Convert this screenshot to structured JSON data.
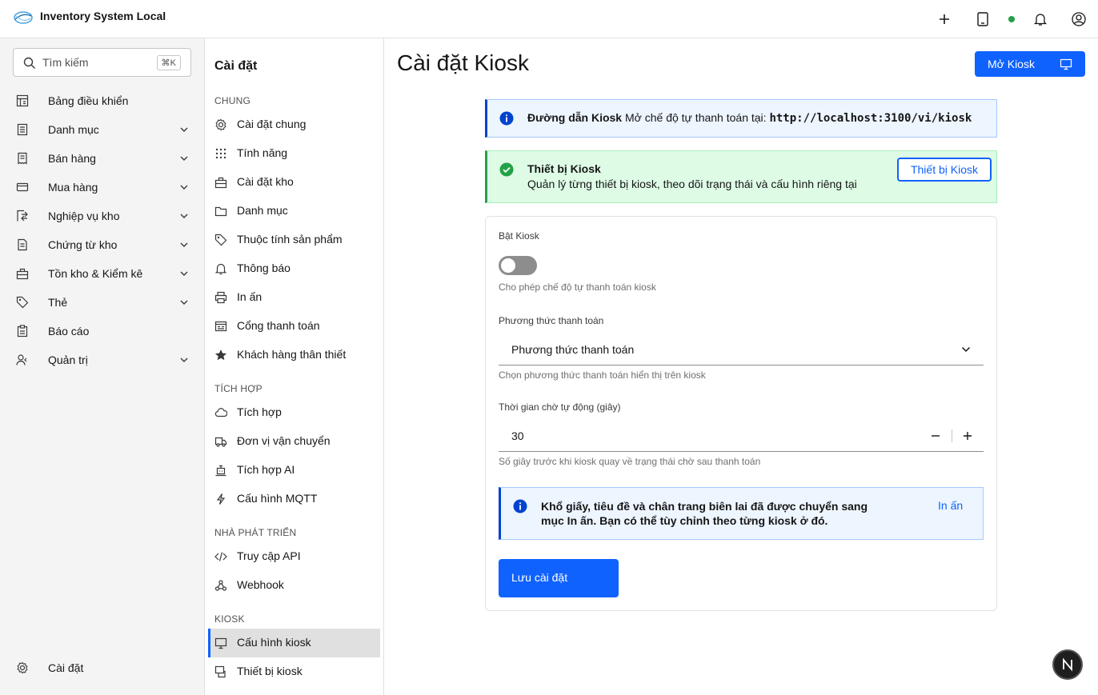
{
  "app": {
    "title": "Inventory System Local"
  },
  "header": {
    "icons": [
      "plus-icon",
      "tablet-icon",
      "status-dot",
      "bell-icon",
      "user-icon"
    ],
    "status_color": "#24a148"
  },
  "sidebar": {
    "search_placeholder": "Tìm kiếm",
    "search_shortcut": "⌘K",
    "items": [
      {
        "label": "Bảng điều khiển",
        "icon": "dashboard-icon",
        "expandable": false
      },
      {
        "label": "Danh mục",
        "icon": "catalog-icon",
        "expandable": true
      },
      {
        "label": "Bán hàng",
        "icon": "sales-icon",
        "expandable": true
      },
      {
        "label": "Mua hàng",
        "icon": "purchase-icon",
        "expandable": true
      },
      {
        "label": "Nghiệp vụ kho",
        "icon": "warehouse-ops-icon",
        "expandable": true
      },
      {
        "label": "Chứng từ kho",
        "icon": "document-icon",
        "expandable": true
      },
      {
        "label": "Tồn kho & Kiểm kê",
        "icon": "inventory-icon",
        "expandable": true
      },
      {
        "label": "Thẻ",
        "icon": "tag-icon",
        "expandable": true
      },
      {
        "label": "Báo cáo",
        "icon": "report-icon",
        "expandable": false
      },
      {
        "label": "Quản trị",
        "icon": "admin-icon",
        "expandable": true
      }
    ],
    "footer_label": "Cài đặt"
  },
  "settings_nav": {
    "title": "Cài đặt",
    "groups": [
      {
        "label": "CHUNG",
        "items": [
          "Cài đặt chung",
          "Tính năng",
          "Cài đặt kho",
          "Danh mục",
          "Thuộc tính sản phẩm",
          "Thông báo",
          "In ấn",
          "Cổng thanh toán",
          "Khách hàng thân thiết"
        ]
      },
      {
        "label": "TÍCH HỢP",
        "items": [
          "Tích hợp",
          "Đơn vị vận chuyển",
          "Tích hợp AI",
          "Cấu hình MQTT"
        ]
      },
      {
        "label": "NHÀ PHÁT TRIỂN",
        "items": [
          "Truy cập API",
          "Webhook"
        ]
      },
      {
        "label": "KIOSK",
        "items": [
          "Cấu hình kiosk",
          "Thiết bị kiosk"
        ]
      }
    ],
    "active_item": "Cấu hình kiosk"
  },
  "main": {
    "title": "Cài đặt Kiosk",
    "open_kiosk_label": "Mở Kiosk",
    "info_notice": {
      "title": "Đường dẫn Kiosk",
      "text": "Mở chế độ tự thanh toán tại:",
      "url": "http://localhost:3100/vi/kiosk"
    },
    "success_notice": {
      "title": "Thiết bị Kiosk",
      "text": "Quản lý từng thiết bị kiosk, theo dõi trạng thái và cấu hình riêng tại",
      "button_label": "Thiết bị Kiosk"
    },
    "form": {
      "enable_label": "Bật Kiosk",
      "enable_value": false,
      "enable_helper": "Cho phép chế độ tự thanh toán kiosk",
      "payment_label": "Phương thức thanh toán",
      "payment_value": "Phương thức thanh toán",
      "payment_helper": "Chọn phương thức thanh toán hiển thị trên kiosk",
      "timeout_label": "Thời gian chờ tự động (giây)",
      "timeout_value": "30",
      "timeout_helper": "Số giây trước khi kiosk quay về trạng thái chờ sau thanh toán",
      "print_notice": "Khổ giấy, tiêu đề và chân trang biên lai đã được chuyển sang mục In ấn. Bạn có thể tùy chỉnh theo từng kiosk ở đó.",
      "print_link": "In ấn",
      "save_label": "Lưu cài đặt"
    }
  },
  "colors": {
    "primary": "#0f62fe",
    "success": "#24a148",
    "info_bg": "#edf5ff",
    "success_bg": "#defbe6"
  },
  "fab_letter": "N"
}
